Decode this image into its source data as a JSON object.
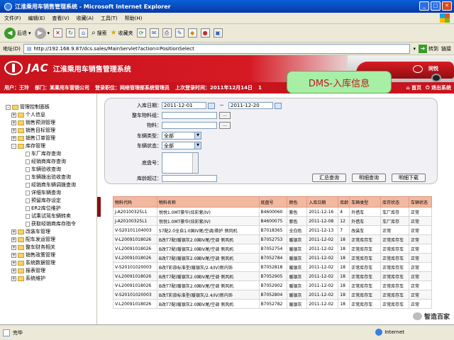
{
  "window": {
    "title": "江淮乘用车销售管理系统 - Microsoft Internet Explorer"
  },
  "menu": [
    "文件(F)",
    "编辑(E)",
    "查看(V)",
    "收藏(A)",
    "工具(T)",
    "帮助(H)"
  ],
  "toolbar": {
    "back": "后退",
    "search": "搜索",
    "favorites": "收藏夹"
  },
  "address": {
    "label": "地址(D)",
    "url": "http://192.168.9.87/dcs.sales/MainServlet?action=PositionSelect",
    "go": "转到",
    "links": "链接"
  },
  "header": {
    "brand": "JAC",
    "system_name": "江淮乘用车销售管理系统",
    "car_brand": "同悦",
    "badge": "DMS-入库信息",
    "info": {
      "user": "用户：王玲",
      "dept": "部门：某乘用车营销公司",
      "position": "登录职位：网络管理部系统管理员",
      "last_login": "上次登录时间：2011年12月14日",
      "extra": "1"
    },
    "actions": {
      "home": "首页",
      "logout": "退出系统"
    }
  },
  "sidebar": {
    "items": [
      {
        "label": "管理控制面板",
        "level": 0,
        "type": "root"
      },
      {
        "label": "个人信息",
        "level": 1,
        "type": "folder",
        "toggle": "+"
      },
      {
        "label": "销售预测管理",
        "level": 1,
        "type": "folder",
        "toggle": "+"
      },
      {
        "label": "销售目标管理",
        "level": 1,
        "type": "folder",
        "toggle": "+"
      },
      {
        "label": "销售订单管理",
        "level": 1,
        "type": "folder",
        "toggle": "+"
      },
      {
        "label": "库存管理",
        "level": 1,
        "type": "folder",
        "toggle": "-"
      },
      {
        "label": "车厂库存查询",
        "level": 2,
        "type": "doc"
      },
      {
        "label": "经销商库存查询",
        "level": 2,
        "type": "doc"
      },
      {
        "label": "车辆验收查询",
        "level": 2,
        "type": "doc"
      },
      {
        "label": "车辆拨出验收查询",
        "level": 2,
        "type": "doc"
      },
      {
        "label": "经销商车辆调拨查询",
        "level": 2,
        "type": "doc"
      },
      {
        "label": "详细车辆查询",
        "level": 2,
        "type": "doc"
      },
      {
        "label": "预留库存设定",
        "level": 2,
        "type": "doc"
      },
      {
        "label": "ER2库位维护",
        "level": 2,
        "type": "doc"
      },
      {
        "label": "试乘试驾车辆转卖",
        "level": 2,
        "type": "doc"
      },
      {
        "label": "获取经销商库存指令",
        "level": 2,
        "type": "doc"
      },
      {
        "label": "改装车管理",
        "level": 1,
        "type": "folder",
        "toggle": "+"
      },
      {
        "label": "配车发运管理",
        "level": 1,
        "type": "folder",
        "toggle": "+"
      },
      {
        "label": "整车财务相关",
        "level": 1,
        "type": "folder",
        "toggle": "+"
      },
      {
        "label": "销售政策管理",
        "level": 1,
        "type": "folder",
        "toggle": "+"
      },
      {
        "label": "系统数据管理",
        "level": 1,
        "type": "folder",
        "toggle": "+"
      },
      {
        "label": "报表管理",
        "level": 1,
        "type": "folder",
        "toggle": "+"
      },
      {
        "label": "系统维护",
        "level": 1,
        "type": "folder",
        "toggle": "+"
      }
    ]
  },
  "form": {
    "date_label": "入库日期：",
    "date_from": "2011-12-01",
    "date_sep": "－",
    "date_to": "2011-12-20",
    "group_label": "整车物料组：",
    "material_label": "物料：",
    "type_label": "车辆类型：",
    "type_value": "全部",
    "status_label": "车辆状态：",
    "status_value": "全部",
    "vin_label": "底盘号：",
    "age_label": "库龄超过：",
    "buttons": {
      "summary": "汇总查询",
      "detail": "明细查询",
      "download": "明细下载"
    }
  },
  "table": {
    "columns": [
      "物料代码",
      "物料名称",
      "底盘号",
      "颜色",
      "入库日期",
      "库龄",
      "车辆类型",
      "库存状态",
      "车辆状态"
    ],
    "rows": [
      [
        "J-A20100325L1",
        "悦悦1.0MT豪华(炫彩紫/IV)",
        "B4600060",
        "紫色",
        "2011-12-16",
        "4",
        "外借车",
        "车厂库存",
        "正常"
      ],
      [
        "J-A20100325L1",
        "悦悦1.0MT豪华(炫彩紫/IV)",
        "B4600075",
        "紫色",
        "2011-12-08",
        "12",
        "外借车",
        "车厂库存",
        "正常"
      ],
      [
        "V-S20101104003",
        "S7配2.0全自1.0国IV尾/空调/救护 侧风机",
        "B7018365",
        "全白色",
        "2011-12-13",
        "7",
        "改装车",
        "正常",
        "正常"
      ],
      [
        "V-L20091018026",
        "B改T7配(暖银灰2.0国IV尾/空调 侧风机",
        "B7052753",
        "暖银灰",
        "2011-12-02",
        "18",
        "正常库存车",
        "正常库存车",
        "正常"
      ],
      [
        "V-L20091018026",
        "B改T7配(暖银灰2.0国IV尾/空调 侧风机",
        "B7052754",
        "暖银灰",
        "2011-12-02",
        "18",
        "正常库存车",
        "正常库存车",
        "正常"
      ],
      [
        "V-L20091018026",
        "B改T7配(暖银灰2.0国IV尾/空调 侧风机",
        "B7052784",
        "暖银灰",
        "2011-12-02",
        "18",
        "正常库存车",
        "正常库存车",
        "正常"
      ],
      [
        "V-S20101020003",
        "B改T彩旅标准型(暖银灰/2.4/IV)新内饰",
        "B7052818",
        "暖银灰",
        "2011-12-02",
        "18",
        "正常库存车",
        "正常库存车",
        "正常"
      ],
      [
        "V-L20091018026",
        "B改T7配(暖银灰2.0国IV尾/空调 侧风机",
        "B7052905",
        "暖银灰",
        "2011-12-02",
        "18",
        "正常库存车",
        "正常库存车",
        "正常"
      ],
      [
        "V-L20091018026",
        "B改T7配(暖银灰2.0国IV尾/空调 侧风机",
        "B7052902",
        "暖银灰",
        "2011-12-02",
        "18",
        "正常库存车",
        "正常库存车",
        "正常"
      ],
      [
        "V-S20101020003",
        "B改T彩旅标准型(暖银灰/2.4/IV)新内饰",
        "B7052804",
        "暖银灰",
        "2011-12-02",
        "18",
        "正常库存车",
        "正常库存车",
        "正常"
      ],
      [
        "V-L20091018026",
        "B改T7配(暖银灰2.0国IV尾/空调 侧风机",
        "B7052782",
        "暖银灰",
        "2011-12-02",
        "18",
        "正常库存车",
        "正常库存车",
        "正常"
      ]
    ]
  },
  "status": {
    "left": "完毕",
    "zone": "Internet"
  },
  "watermark": "智造百家",
  "colors": {
    "brand_red": "#c8141e",
    "header_row": "#f2b8a0",
    "badge_green": "#a6efa5"
  }
}
